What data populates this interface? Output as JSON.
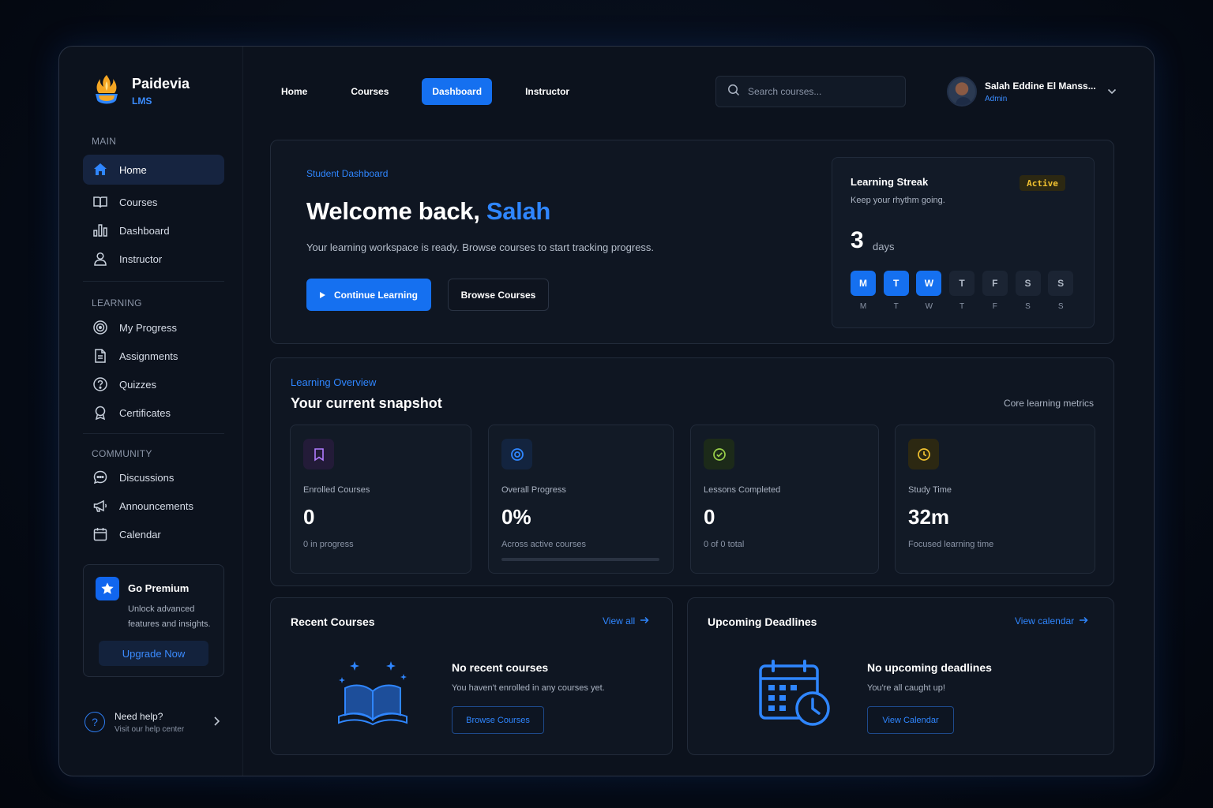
{
  "brand": {
    "name": "Paidevia",
    "sub": "LMS"
  },
  "sidebar": {
    "sections": [
      {
        "label": "MAIN"
      },
      {
        "label": "LEARNING"
      },
      {
        "label": "COMMUNITY"
      }
    ],
    "items": [
      {
        "label": "Home",
        "icon": "home-icon"
      },
      {
        "label": "Courses",
        "icon": "book-icon"
      },
      {
        "label": "Dashboard",
        "icon": "bar-chart-icon"
      },
      {
        "label": "Instructor",
        "icon": "user-icon"
      },
      {
        "label": "My Progress",
        "icon": "target-icon"
      },
      {
        "label": "Assignments",
        "icon": "document-icon"
      },
      {
        "label": "Quizzes",
        "icon": "question-icon"
      },
      {
        "label": "Certificates",
        "icon": "award-icon"
      },
      {
        "label": "Discussions",
        "icon": "chat-icon"
      },
      {
        "label": "Announcements",
        "icon": "megaphone-icon"
      },
      {
        "label": "Calendar",
        "icon": "calendar-icon"
      }
    ],
    "premium": {
      "title": "Go Premium",
      "desc": "Unlock advanced features and insights.",
      "button": "Upgrade Now"
    },
    "help": {
      "title": "Need help?",
      "sub": "Visit our help center"
    }
  },
  "topnav": {
    "tabs": [
      "Home",
      "Courses",
      "Dashboard",
      "Instructor"
    ],
    "active": "Dashboard",
    "search_placeholder": "Search courses...",
    "user": {
      "name": "Salah Eddine El Manss...",
      "role": "Admin"
    }
  },
  "hero": {
    "kicker": "Student Dashboard",
    "greeting": "Welcome back,",
    "name": "Salah",
    "sub": "Your learning workspace is ready. Browse courses to start tracking progress.",
    "primary_button": "Continue Learning",
    "secondary_button": "Browse Courses"
  },
  "streak": {
    "title": "Learning Streak",
    "sub": "Keep your rhythm going.",
    "badge": "Active",
    "count": "3",
    "unit": "days",
    "days": [
      {
        "label": "M",
        "active": true
      },
      {
        "label": "T",
        "active": true
      },
      {
        "label": "W",
        "active": true
      },
      {
        "label": "T",
        "active": false
      },
      {
        "label": "F",
        "active": false
      },
      {
        "label": "S",
        "active": false
      },
      {
        "label": "S",
        "active": false
      }
    ]
  },
  "overview": {
    "kicker": "Learning Overview",
    "title": "Your current snapshot",
    "right": "Core learning metrics",
    "stats": [
      {
        "label": "Enrolled Courses",
        "value": "0",
        "foot": "0 in progress",
        "color": "#b07cff"
      },
      {
        "label": "Overall Progress",
        "value": "0%",
        "foot": "Across active courses",
        "color": "#2f86ff",
        "progress": 0
      },
      {
        "label": "Lessons Completed",
        "value": "0",
        "foot": "0 of 0 total",
        "color": "#9bd14a"
      },
      {
        "label": "Study Time",
        "value": "32m",
        "foot": "Focused learning time",
        "color": "#f2c230"
      }
    ]
  },
  "recent": {
    "title": "Recent Courses",
    "link": "View all",
    "empty_title": "No recent courses",
    "empty_sub": "You haven't enrolled in any courses yet.",
    "button": "Browse Courses"
  },
  "deadlines": {
    "title": "Upcoming Deadlines",
    "link": "View calendar",
    "empty_title": "No upcoming deadlines",
    "empty_sub": "You're all caught up!",
    "button": "View Calendar"
  }
}
